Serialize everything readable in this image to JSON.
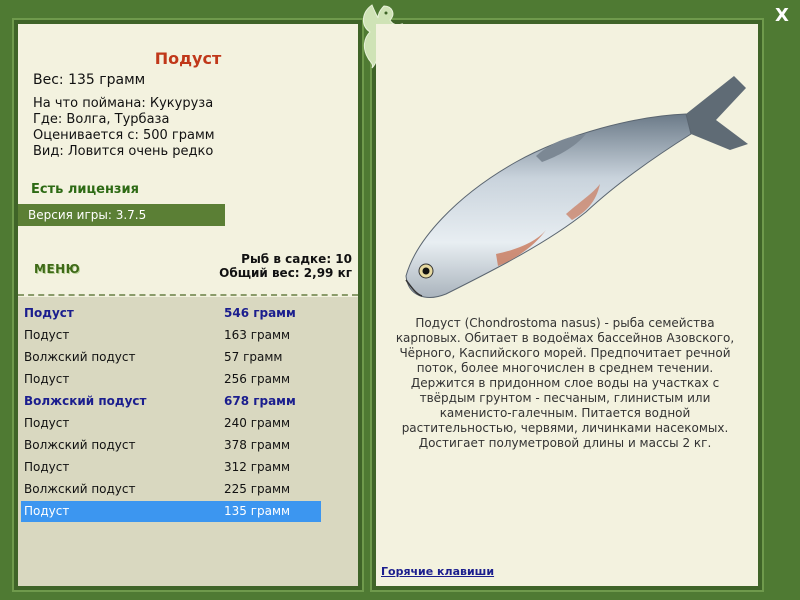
{
  "window": {
    "close_label": "X"
  },
  "fish_card": {
    "title": "Подуст",
    "weight": "Вес: 135 грамм",
    "caught_on": "На что поймана: Кукуруза",
    "where": "Где: Волга, Турбаза",
    "valued_from": "Оценивается с: 500 грамм",
    "rarity": "Вид: Ловится очень редко"
  },
  "license": "Есть лицензия",
  "version": "Версия игры: 3.7.5",
  "menu_label": "МЕНЮ",
  "cage": {
    "count": "Рыб в садке: 10",
    "total": "Общий вес: 2,99 кг"
  },
  "catch_list": [
    {
      "name": "Подуст",
      "weight": "546 грамм",
      "bold": true,
      "selected": false
    },
    {
      "name": "Подуст",
      "weight": "163 грамм",
      "bold": false,
      "selected": false
    },
    {
      "name": "Волжский подуст",
      "weight": "57 грамм",
      "bold": false,
      "selected": false
    },
    {
      "name": "Подуст",
      "weight": "256 грамм",
      "bold": false,
      "selected": false
    },
    {
      "name": "Волжский подуст",
      "weight": "678 грамм",
      "bold": true,
      "selected": false
    },
    {
      "name": "Подуст",
      "weight": "240 грамм",
      "bold": false,
      "selected": false
    },
    {
      "name": "Волжский подуст",
      "weight": "378 грамм",
      "bold": false,
      "selected": false
    },
    {
      "name": "Подуст",
      "weight": "312 грамм",
      "bold": false,
      "selected": false
    },
    {
      "name": "Волжский подуст",
      "weight": "225 грамм",
      "bold": false,
      "selected": false
    },
    {
      "name": "Подуст",
      "weight": "135 грамм",
      "bold": false,
      "selected": true
    }
  ],
  "description": "Подуст (Chondrostoma nasus) - рыба семейства карповых. Обитает в водоёмах бассейнов Азовского, Чёрного, Каспийского морей. Предпочитает речной поток, более многочислен в среднем течении. Держится в придонном слое воды на участках с твёрдым грунтом - песчаным, глинистым или каменисто-галечным. Питается водной растительностью, червями, личинками насекомых. Достигает полуметровой длины и массы 2 кг.",
  "hotkeys_link": "Горячие клавиши",
  "colors": {
    "frame": "#4f7a33",
    "panel": "#f3f2df",
    "title_red": "#c0381a",
    "link_blue": "#1b1e8e",
    "selection": "#3c96f0"
  },
  "icons": [
    "fish-logo-icon",
    "close-icon",
    "fish-illustration"
  ]
}
